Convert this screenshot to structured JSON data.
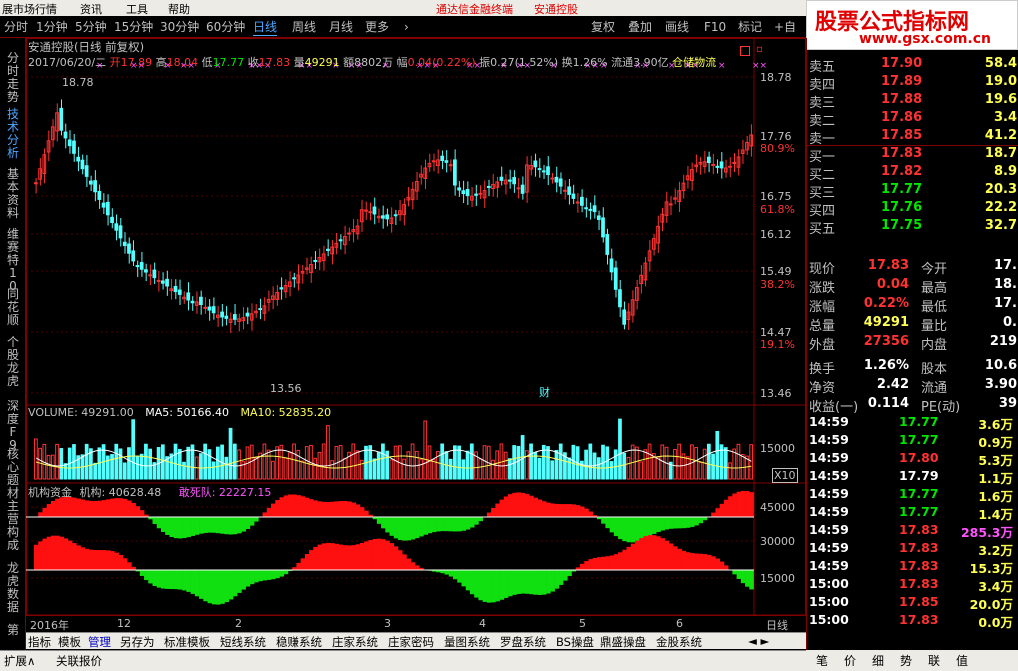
{
  "menubar": {
    "m1": "展市场行情",
    "m2": "资讯",
    "m3": "工具",
    "m4": "帮助",
    "ad1": "通达信金融终端",
    "ad2": "安通控股"
  },
  "toolbar": {
    "periods": [
      "分时",
      "1分钟",
      "5分钟",
      "15分钟",
      "30分钟",
      "60分钟",
      "日线",
      "周线",
      "月线",
      "更多"
    ],
    "more_arrow": "›",
    "right": [
      "复权",
      "叠加",
      "画线",
      "F10",
      "标记",
      "+自"
    ]
  },
  "logo": {
    "title": "股票公式指标网",
    "url": "www.gsx.com.cn"
  },
  "left_tabs": [
    "分时走势",
    "技术分析",
    "基本资料",
    "维赛特10",
    "同花顺",
    "个股龙虎",
    "深度F9",
    "核心题材",
    "主营构成",
    "龙虎数据",
    "第"
  ],
  "chart_header": {
    "name": "安通控股(日线 前复权)",
    "date": "2017/06/20/二",
    "open_l": "开",
    "open": "17.89",
    "high_l": "高",
    "high": "18.04",
    "low_l": "低",
    "low": "17.77",
    "close_l": "收",
    "close": "17.83",
    "vol_l": "量",
    "vol": "49291",
    "amt_l": "额",
    "amt": "8802万",
    "chg_l": "幅",
    "chg": "0.04(0.22%)",
    "amp_l": "振",
    "amp": "0.27(1.52%)",
    "turn_l": "换",
    "turn": "1.26%",
    "float_l": "流通",
    "float": "3.90亿",
    "concept": "仓储物流"
  },
  "price_axis": [
    "18.78",
    "17.76",
    "80.9%",
    "16.75",
    "61.8%",
    "16.12",
    "15.49",
    "38.2%",
    "14.47",
    "19.1%",
    "13.46"
  ],
  "annotations": {
    "high": "18.78",
    "low": "13.56",
    "signal": "财"
  },
  "volume_panel": {
    "title": "VOLUME: 49291.00",
    "ma5": "MA5: 50166.40",
    "ma10": "MA10: 52835.20",
    "axis": [
      "15000"
    ],
    "scale": "X10"
  },
  "indicator_panel": {
    "title": "机构资金",
    "jg": "机构: 40628.48",
    "gsd": "敢死队: 22227.15",
    "axis": [
      "45000",
      "30000",
      "15000"
    ]
  },
  "xaxis": {
    "labels": [
      "2016年",
      "12",
      "2",
      "3",
      "4",
      "5",
      "6"
    ],
    "period": "日线"
  },
  "orderbook": [
    {
      "label": "卖五",
      "price": "17.90",
      "vol": "58.4",
      "cls": "up"
    },
    {
      "label": "卖四",
      "price": "17.89",
      "vol": "19.0",
      "cls": "up"
    },
    {
      "label": "卖三",
      "price": "17.88",
      "vol": "19.6",
      "cls": "up"
    },
    {
      "label": "卖二",
      "price": "17.86",
      "vol": "3.4",
      "cls": "up"
    },
    {
      "label": "卖一",
      "price": "17.85",
      "vol": "41.2",
      "cls": "up"
    },
    {
      "label": "买一",
      "price": "17.83",
      "vol": "18.7",
      "cls": "up"
    },
    {
      "label": "买二",
      "price": "17.82",
      "vol": "8.9",
      "cls": "up"
    },
    {
      "label": "买三",
      "price": "17.77",
      "vol": "20.3",
      "cls": "dn"
    },
    {
      "label": "买四",
      "price": "17.76",
      "vol": "22.2",
      "cls": "dn"
    },
    {
      "label": "买五",
      "price": "17.75",
      "vol": "32.7",
      "cls": "dn"
    }
  ],
  "quote": [
    {
      "a": "现价",
      "av": "17.83",
      "ac": "up",
      "b": "今开",
      "bv": "17."
    },
    {
      "a": "涨跌",
      "av": "0.04",
      "ac": "up",
      "b": "最高",
      "bv": "18."
    },
    {
      "a": "涨幅",
      "av": "0.22%",
      "ac": "up",
      "b": "最低",
      "bv": "17."
    },
    {
      "a": "总量",
      "av": "49291",
      "ac": "yl",
      "b": "量比",
      "bv": "0."
    },
    {
      "a": "外盘",
      "av": "27356",
      "ac": "up",
      "b": "内盘",
      "bv": "219"
    },
    {
      "a": "换手",
      "av": "1.26%",
      "ac": "wt",
      "b": "股本",
      "bv": "10.6"
    },
    {
      "a": "净资",
      "av": "2.42",
      "ac": "wt",
      "b": "流通",
      "bv": "3.90"
    },
    {
      "a": "收益(一)",
      "av": "0.114",
      "ac": "wt",
      "b": "PE(动)",
      "bv": "39"
    }
  ],
  "ticks": [
    {
      "t": "14:59",
      "p": "17.77",
      "pc": "dn",
      "v": "3.6万",
      "vc": "yl"
    },
    {
      "t": "14:59",
      "p": "17.77",
      "pc": "dn",
      "v": "0.9万",
      "vc": "yl"
    },
    {
      "t": "14:59",
      "p": "17.80",
      "pc": "up",
      "v": "5.3万",
      "vc": "yl"
    },
    {
      "t": "14:59",
      "p": "17.79",
      "pc": "wt",
      "v": "1.1万",
      "vc": "yl"
    },
    {
      "t": "14:59",
      "p": "17.77",
      "pc": "dn",
      "v": "1.6万",
      "vc": "yl"
    },
    {
      "t": "14:59",
      "p": "17.77",
      "pc": "dn",
      "v": "1.4万",
      "vc": "yl"
    },
    {
      "t": "14:59",
      "p": "17.83",
      "pc": "up",
      "v": "285.3万",
      "vc": "pu"
    },
    {
      "t": "14:59",
      "p": "17.83",
      "pc": "up",
      "v": "3.2万",
      "vc": "yl"
    },
    {
      "t": "14:59",
      "p": "17.83",
      "pc": "up",
      "v": "15.3万",
      "vc": "yl"
    },
    {
      "t": "15:00",
      "p": "17.83",
      "pc": "up",
      "v": "3.4万",
      "vc": "yl"
    },
    {
      "t": "15:00",
      "p": "17.85",
      "pc": "up",
      "v": "20.0万",
      "vc": "yl"
    },
    {
      "t": "15:00",
      "p": "17.83",
      "pc": "up",
      "v": "0.0万",
      "vc": "yl"
    }
  ],
  "right_bottom": [
    "笔",
    "价",
    "细",
    "势",
    "联",
    "值"
  ],
  "bottom_tabs": [
    "指标",
    "模板",
    "管理",
    "另存为",
    "标准模板",
    "短线系统",
    "稳赚系统",
    "庄家系统",
    "庄家密码",
    "量图系统",
    "罗盘系统",
    "BS操盘",
    "鼎盛操盘",
    "金股系统"
  ],
  "statusbar": {
    "s1": "扩展∧",
    "s2": "关联报价"
  },
  "colors": {
    "up": "#ff3232",
    "down": "#54ffff",
    "green": "#00e600",
    "yellow": "#ffff54",
    "purple": "#ff54ff",
    "frame": "#800000"
  }
}
